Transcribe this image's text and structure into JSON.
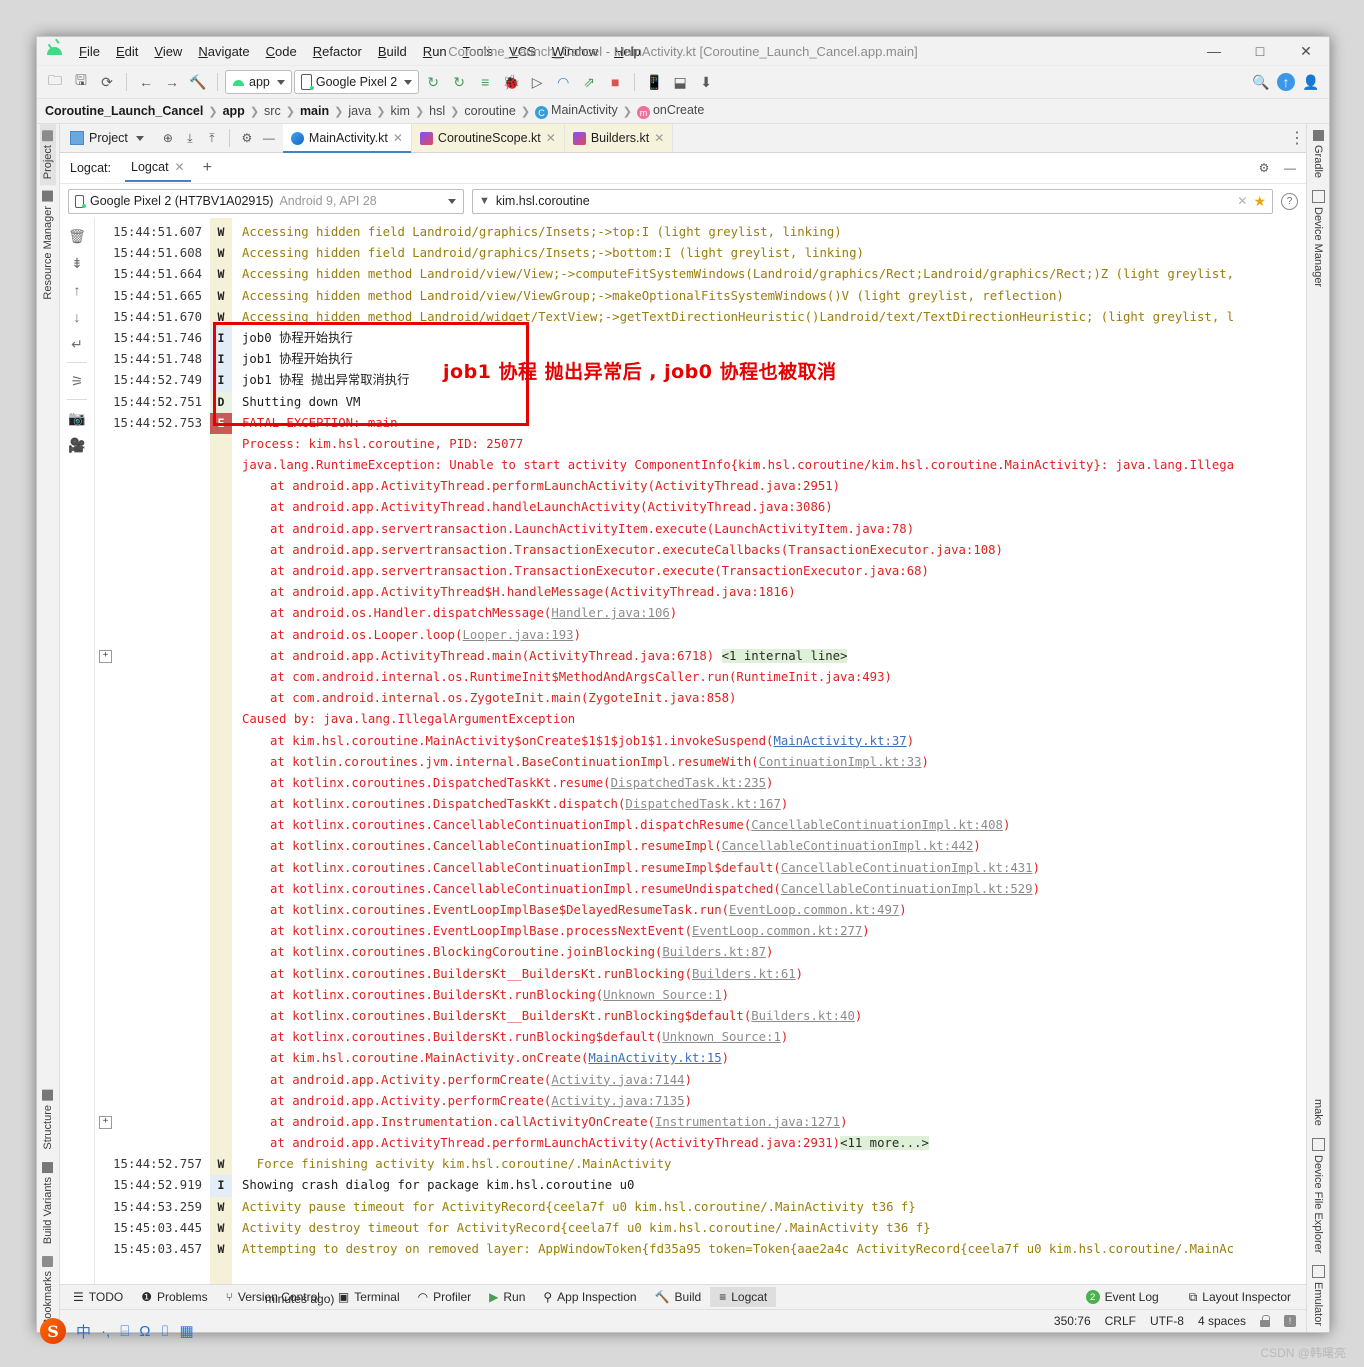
{
  "window": {
    "title": "Coroutine_Launch_Cancel - MainActivity.kt [Coroutine_Launch_Cancel.app.main]",
    "minimize": "—",
    "maximize": "□",
    "close": "✕"
  },
  "menubar": {
    "items": [
      "File",
      "Edit",
      "View",
      "Navigate",
      "Code",
      "Refactor",
      "Build",
      "Run",
      "Tools",
      "VCS",
      "Window",
      "Help"
    ]
  },
  "toolbar": {
    "run_config": "app",
    "device": "Google Pixel 2"
  },
  "breadcrumb": {
    "items": [
      {
        "label": "Coroutine_Launch_Cancel",
        "bold": true
      },
      {
        "label": "app",
        "bold": true
      },
      {
        "label": "src",
        "bold": false
      },
      {
        "label": "main",
        "bold": true
      },
      {
        "label": "java",
        "bold": false
      },
      {
        "label": "kim",
        "bold": false
      },
      {
        "label": "hsl",
        "bold": false
      },
      {
        "label": "coroutine",
        "bold": false
      },
      {
        "label": "MainActivity",
        "bold": false,
        "icon": "C"
      },
      {
        "label": "onCreate",
        "bold": false,
        "icon": "m"
      }
    ]
  },
  "left_rail": {
    "items": [
      "Project",
      "Resource Manager",
      "Structure",
      "Build Variants",
      "Bookmarks"
    ]
  },
  "right_rail": {
    "items": [
      "Gradle",
      "Device Manager",
      "make",
      "Device File Explorer",
      "Emulator"
    ]
  },
  "project_panel": {
    "label": "Project"
  },
  "editor_tabs": [
    {
      "label": "MainActivity.kt",
      "active": true
    },
    {
      "label": "CoroutineScope.kt",
      "active": false
    },
    {
      "label": "Builders.kt",
      "active": false
    }
  ],
  "logcat_header": {
    "label": "Logcat:",
    "tab": "Logcat",
    "close": "✕",
    "add": "+"
  },
  "filter": {
    "device": "Google Pixel 2 (HT7BV1A02915)",
    "device_meta": "Android 9, API 28",
    "search_value": "kim.hsl.coroutine",
    "clear": "✕",
    "star": "★",
    "help": "?"
  },
  "annotation": {
    "text": "job1 协程 抛出异常后 , job0 协程也被取消",
    "color": "#e60000"
  },
  "log_lines": [
    {
      "ts": "15:44:51.607",
      "lvl": "W",
      "cls": "c-warn",
      "msg": "Accessing hidden field Landroid/graphics/Insets;->top:I (light greylist, linking)"
    },
    {
      "ts": "15:44:51.608",
      "lvl": "W",
      "cls": "c-warn",
      "msg": "Accessing hidden field Landroid/graphics/Insets;->bottom:I (light greylist, linking)"
    },
    {
      "ts": "15:44:51.664",
      "lvl": "W",
      "cls": "c-warn",
      "msg": "Accessing hidden method Landroid/view/View;->computeFitSystemWindows(Landroid/graphics/Rect;Landroid/graphics/Rect;)Z (light greylist,"
    },
    {
      "ts": "15:44:51.665",
      "lvl": "W",
      "cls": "c-warn",
      "msg": "Accessing hidden method Landroid/view/ViewGroup;->makeOptionalFitsSystemWindows()V (light greylist, reflection)"
    },
    {
      "ts": "15:44:51.670",
      "lvl": "W",
      "cls": "c-warn",
      "msg": "Accessing hidden method Landroid/widget/TextView;->getTextDirectionHeuristic()Landroid/text/TextDirectionHeuristic; (light greylist, l"
    },
    {
      "ts": "15:44:51.746",
      "lvl": "I",
      "cls": "c-info",
      "msg": "job0 协程开始执行"
    },
    {
      "ts": "15:44:51.748",
      "lvl": "I",
      "cls": "c-info",
      "msg": "job1 协程开始执行"
    },
    {
      "ts": "15:44:52.749",
      "lvl": "I",
      "cls": "c-info",
      "msg": "job1 协程 抛出异常取消执行"
    },
    {
      "ts": "15:44:52.751",
      "lvl": "D",
      "cls": "c-debug",
      "msg": "Shutting down VM"
    },
    {
      "ts": "15:44:52.753",
      "lvl": "E",
      "cls": "c-err",
      "msg": "FATAL EXCEPTION: main"
    },
    {
      "ts": "",
      "lvl": "",
      "cls": "c-err",
      "msg": "Process: kim.hsl.coroutine, PID: 25077",
      "indent": 0
    },
    {
      "ts": "",
      "lvl": "",
      "cls": "c-err",
      "msg": "java.lang.RuntimeException: Unable to start activity ComponentInfo{kim.hsl.coroutine/kim.hsl.coroutine.MainActivity}: java.lang.Illega",
      "indent": 0
    },
    {
      "ts": "",
      "lvl": "",
      "cls": "c-err",
      "msg": "at android.app.ActivityThread.performLaunchActivity(ActivityThread.java:2951)",
      "indent": 1
    },
    {
      "ts": "",
      "lvl": "",
      "cls": "c-err",
      "msg": "at android.app.ActivityThread.handleLaunchActivity(ActivityThread.java:3086)",
      "indent": 1
    },
    {
      "ts": "",
      "lvl": "",
      "cls": "c-err",
      "msg": "at android.app.servertransaction.LaunchActivityItem.execute(LaunchActivityItem.java:78)",
      "indent": 1
    },
    {
      "ts": "",
      "lvl": "",
      "cls": "c-err",
      "msg": "at android.app.servertransaction.TransactionExecutor.executeCallbacks(TransactionExecutor.java:108)",
      "indent": 1
    },
    {
      "ts": "",
      "lvl": "",
      "cls": "c-err",
      "msg": "at android.app.servertransaction.TransactionExecutor.execute(TransactionExecutor.java:68)",
      "indent": 1
    },
    {
      "ts": "",
      "lvl": "",
      "cls": "c-err",
      "msg": "at android.app.ActivityThread$H.handleMessage(ActivityThread.java:1816)",
      "indent": 1
    },
    {
      "ts": "",
      "lvl": "",
      "cls": "c-err",
      "msg": "at android.os.Handler.dispatchMessage(",
      "link": "Handler.java:106",
      "link_cls": "c-graylink",
      "tail": ")",
      "indent": 1
    },
    {
      "ts": "",
      "lvl": "",
      "cls": "c-err",
      "msg": "at android.os.Looper.loop(",
      "link": "Looper.java:193",
      "link_cls": "c-graylink",
      "tail": ")",
      "indent": 1
    },
    {
      "ts": "",
      "lvl": "",
      "cls": "c-err",
      "msg": "at android.app.ActivityThread.main(ActivityThread.java:6718) ",
      "internal": "<1 internal line>",
      "indent": 1
    },
    {
      "ts": "",
      "lvl": "",
      "cls": "c-err",
      "msg": "at com.android.internal.os.RuntimeInit$MethodAndArgsCaller.run(RuntimeInit.java:493)",
      "indent": 1
    },
    {
      "ts": "",
      "lvl": "",
      "cls": "c-err",
      "msg": "at com.android.internal.os.ZygoteInit.main(ZygoteInit.java:858)",
      "indent": 1
    },
    {
      "ts": "",
      "lvl": "",
      "cls": "c-err",
      "msg": "Caused by: java.lang.IllegalArgumentException",
      "indent": 0
    },
    {
      "ts": "",
      "lvl": "",
      "cls": "c-err",
      "msg": "at kim.hsl.coroutine.MainActivity$onCreate$1$1$job1$1.invokeSuspend(",
      "link": "MainActivity.kt:37",
      "link_cls": "c-link",
      "tail": ")",
      "indent": 1
    },
    {
      "ts": "",
      "lvl": "",
      "cls": "c-err",
      "msg": "at kotlin.coroutines.jvm.internal.BaseContinuationImpl.resumeWith(",
      "link": "ContinuationImpl.kt:33",
      "link_cls": "c-graylink",
      "tail": ")",
      "indent": 1
    },
    {
      "ts": "",
      "lvl": "",
      "cls": "c-err",
      "msg": "at kotlinx.coroutines.DispatchedTaskKt.resume(",
      "link": "DispatchedTask.kt:235",
      "link_cls": "c-graylink",
      "tail": ")",
      "indent": 1
    },
    {
      "ts": "",
      "lvl": "",
      "cls": "c-err",
      "msg": "at kotlinx.coroutines.DispatchedTaskKt.dispatch(",
      "link": "DispatchedTask.kt:167",
      "link_cls": "c-graylink",
      "tail": ")",
      "indent": 1
    },
    {
      "ts": "",
      "lvl": "",
      "cls": "c-err",
      "msg": "at kotlinx.coroutines.CancellableContinuationImpl.dispatchResume(",
      "link": "CancellableContinuationImpl.kt:408",
      "link_cls": "c-graylink",
      "tail": ")",
      "indent": 1
    },
    {
      "ts": "",
      "lvl": "",
      "cls": "c-err",
      "msg": "at kotlinx.coroutines.CancellableContinuationImpl.resumeImpl(",
      "link": "CancellableContinuationImpl.kt:442",
      "link_cls": "c-graylink",
      "tail": ")",
      "indent": 1
    },
    {
      "ts": "",
      "lvl": "",
      "cls": "c-err",
      "msg": "at kotlinx.coroutines.CancellableContinuationImpl.resumeImpl$default(",
      "link": "CancellableContinuationImpl.kt:431",
      "link_cls": "c-graylink",
      "tail": ")",
      "indent": 1
    },
    {
      "ts": "",
      "lvl": "",
      "cls": "c-err",
      "msg": "at kotlinx.coroutines.CancellableContinuationImpl.resumeUndispatched(",
      "link": "CancellableContinuationImpl.kt:529",
      "link_cls": "c-graylink",
      "tail": ")",
      "indent": 1
    },
    {
      "ts": "",
      "lvl": "",
      "cls": "c-err",
      "msg": "at kotlinx.coroutines.EventLoopImplBase$DelayedResumeTask.run(",
      "link": "EventLoop.common.kt:497",
      "link_cls": "c-graylink",
      "tail": ")",
      "indent": 1
    },
    {
      "ts": "",
      "lvl": "",
      "cls": "c-err",
      "msg": "at kotlinx.coroutines.EventLoopImplBase.processNextEvent(",
      "link": "EventLoop.common.kt:277",
      "link_cls": "c-graylink",
      "tail": ")",
      "indent": 1
    },
    {
      "ts": "",
      "lvl": "",
      "cls": "c-err",
      "msg": "at kotlinx.coroutines.BlockingCoroutine.joinBlocking(",
      "link": "Builders.kt:87",
      "link_cls": "c-graylink",
      "tail": ")",
      "indent": 1
    },
    {
      "ts": "",
      "lvl": "",
      "cls": "c-err",
      "msg": "at kotlinx.coroutines.BuildersKt__BuildersKt.runBlocking(",
      "link": "Builders.kt:61",
      "link_cls": "c-graylink",
      "tail": ")",
      "indent": 1
    },
    {
      "ts": "",
      "lvl": "",
      "cls": "c-err",
      "msg": "at kotlinx.coroutines.BuildersKt.runBlocking(",
      "link": "Unknown Source:1",
      "link_cls": "c-graylink",
      "tail": ")",
      "indent": 1
    },
    {
      "ts": "",
      "lvl": "",
      "cls": "c-err",
      "msg": "at kotlinx.coroutines.BuildersKt__BuildersKt.runBlocking$default(",
      "link": "Builders.kt:40",
      "link_cls": "c-graylink",
      "tail": ")",
      "indent": 1
    },
    {
      "ts": "",
      "lvl": "",
      "cls": "c-err",
      "msg": "at kotlinx.coroutines.BuildersKt.runBlocking$default(",
      "link": "Unknown Source:1",
      "link_cls": "c-graylink",
      "tail": ")",
      "indent": 1
    },
    {
      "ts": "",
      "lvl": "",
      "cls": "c-err",
      "msg": "at kim.hsl.coroutine.MainActivity.onCreate(",
      "link": "MainActivity.kt:15",
      "link_cls": "c-link",
      "tail": ")",
      "indent": 1
    },
    {
      "ts": "",
      "lvl": "",
      "cls": "c-err",
      "msg": "at android.app.Activity.performCreate(",
      "link": "Activity.java:7144",
      "link_cls": "c-graylink",
      "tail": ")",
      "indent": 1
    },
    {
      "ts": "",
      "lvl": "",
      "cls": "c-err",
      "msg": "at android.app.Activity.performCreate(",
      "link": "Activity.java:7135",
      "link_cls": "c-graylink",
      "tail": ")",
      "indent": 1
    },
    {
      "ts": "",
      "lvl": "",
      "cls": "c-err",
      "msg": "at android.app.Instrumentation.callActivityOnCreate(",
      "link": "Instrumentation.java:1271",
      "link_cls": "c-graylink",
      "tail": ")",
      "indent": 1
    },
    {
      "ts": "",
      "lvl": "",
      "cls": "c-err",
      "msg": "at android.app.ActivityThread.performLaunchActivity(ActivityThread.java:2931)",
      "internal": "<11 more...>",
      "indent": 1
    },
    {
      "ts": "15:44:52.757",
      "lvl": "W",
      "cls": "c-warn",
      "msg": "  Force finishing activity kim.hsl.coroutine/.MainActivity"
    },
    {
      "ts": "15:44:52.919",
      "lvl": "I",
      "cls": "c-info",
      "msg": "Showing crash dialog for package kim.hsl.coroutine u0"
    },
    {
      "ts": "15:44:53.259",
      "lvl": "W",
      "cls": "c-warn",
      "msg": "Activity pause timeout for ActivityRecord{ceela7f u0 kim.hsl.coroutine/.MainActivity t36 f}"
    },
    {
      "ts": "15:45:03.445",
      "lvl": "W",
      "cls": "c-warn",
      "msg": "Activity destroy timeout for ActivityRecord{ceela7f u0 kim.hsl.coroutine/.MainActivity t36 f}"
    },
    {
      "ts": "15:45:03.457",
      "lvl": "W",
      "cls": "c-warn",
      "msg": "Attempting to destroy on removed layer: AppWindowToken{fd35a95 token=Token{aae2a4c ActivityRecord{ceela7f u0 kim.hsl.coroutine/.MainAc"
    }
  ],
  "tool_window_bar": {
    "left": [
      "TODO",
      "Problems",
      "Version Control",
      "Terminal",
      "Profiler",
      "Run",
      "App Inspection",
      "Build",
      "Logcat"
    ],
    "active": "Logcat",
    "right": [
      {
        "label": "Event Log",
        "badge": "2"
      },
      {
        "label": "Layout Inspector",
        "badge": ""
      }
    ]
  },
  "status_bar": {
    "minutes_ago": "minutes ago)",
    "caret": "350:76",
    "line_sep": "CRLF",
    "encoding": "UTF-8",
    "indent": "4 spaces"
  },
  "ime": {
    "logo": "S",
    "items": [
      "中",
      "·,",
      "⌸",
      "Ω",
      "⌷",
      "▦"
    ]
  },
  "watermark": "CSDN @韩曙亮"
}
